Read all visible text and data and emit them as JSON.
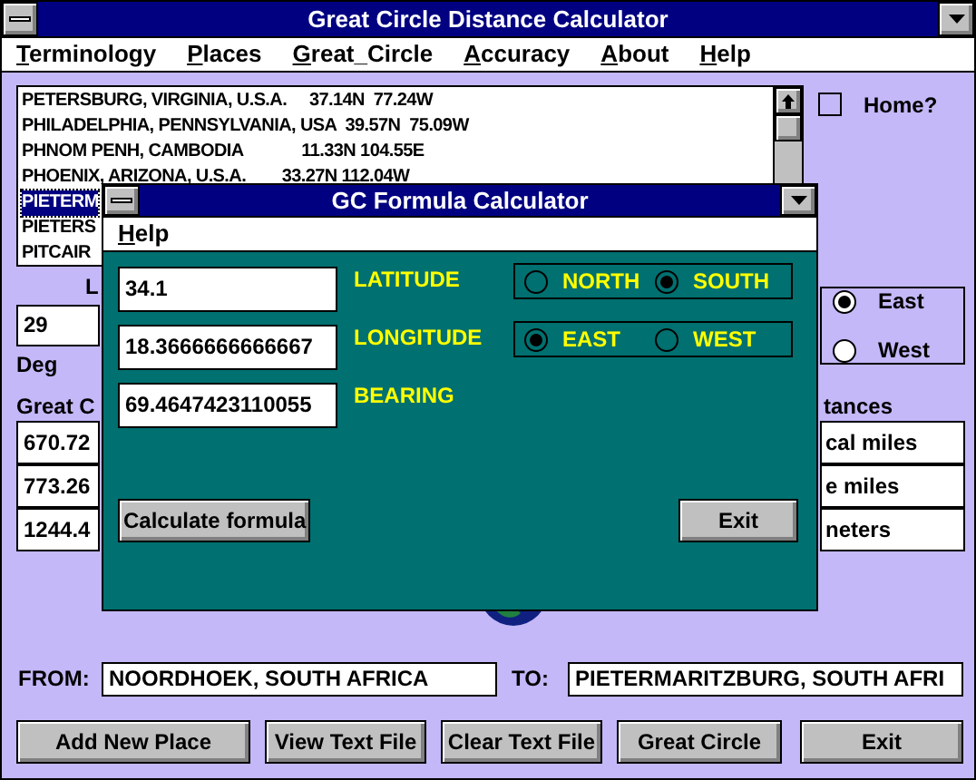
{
  "window": {
    "title": "Great Circle Distance Calculator"
  },
  "menu": [
    {
      "label": "Terminology"
    },
    {
      "label": "Places"
    },
    {
      "label": "Great_Circle"
    },
    {
      "label": "Accuracy"
    },
    {
      "label": "About"
    },
    {
      "label": "Help"
    }
  ],
  "places_list": [
    {
      "text": "PETERSBURG, VIRGINIA, U.S.A.     37.14N  77.24W",
      "selected": false
    },
    {
      "text": "PHILADELPHIA, PENNSYLVANIA, USA  39.57N  75.09W",
      "selected": false
    },
    {
      "text": "PHNOM PENH, CAMBODIA             11.33N 104.55E",
      "selected": false
    },
    {
      "text": "PHOENIX, ARIZONA, U.S.A.        33.27N 112.04W",
      "selected": false
    },
    {
      "text": "PIETERM",
      "selected": true
    },
    {
      "text": "PIETERS",
      "selected": false
    },
    {
      "text": "PITCAIR",
      "selected": false
    }
  ],
  "home_checkbox": {
    "label": "Home?",
    "checked": false
  },
  "longitude_label": "L",
  "degrees_field": {
    "value": "29",
    "unit": "Deg"
  },
  "hemisphere": [
    {
      "label": "East",
      "selected": true
    },
    {
      "label": "West",
      "selected": false
    }
  ],
  "results_label": "Great C",
  "distances_label": "tances",
  "results": [
    {
      "value": "670.72",
      "unit": "cal miles"
    },
    {
      "value": "773.26",
      "unit": "e miles"
    },
    {
      "value": "1244.4",
      "unit": "neters"
    }
  ],
  "from": {
    "label": "FROM:",
    "value": "NOORDHOEK, SOUTH AFRICA"
  },
  "to": {
    "label": "TO:",
    "value": "PIETERMARITZBURG, SOUTH AFRI"
  },
  "buttons": [
    "Add New Place",
    "View Text File",
    "Clear Text File",
    "Great Circle",
    "Exit"
  ],
  "dialog": {
    "title": "GC Formula Calculator",
    "menu": [
      {
        "label": "Help"
      }
    ],
    "rows": [
      {
        "value": "34.1",
        "label": "LATITUDE",
        "options": [
          {
            "label": "NORTH",
            "selected": false
          },
          {
            "label": "SOUTH",
            "selected": true
          }
        ]
      },
      {
        "value": "18.3666666666667",
        "label": "LONGITUDE",
        "options": [
          {
            "label": "EAST",
            "selected": true
          },
          {
            "label": "WEST",
            "selected": false
          }
        ]
      },
      {
        "value": "69.4647423110055",
        "label": "BEARING"
      }
    ],
    "buttons": [
      "Calculate formula",
      "Exit"
    ]
  }
}
